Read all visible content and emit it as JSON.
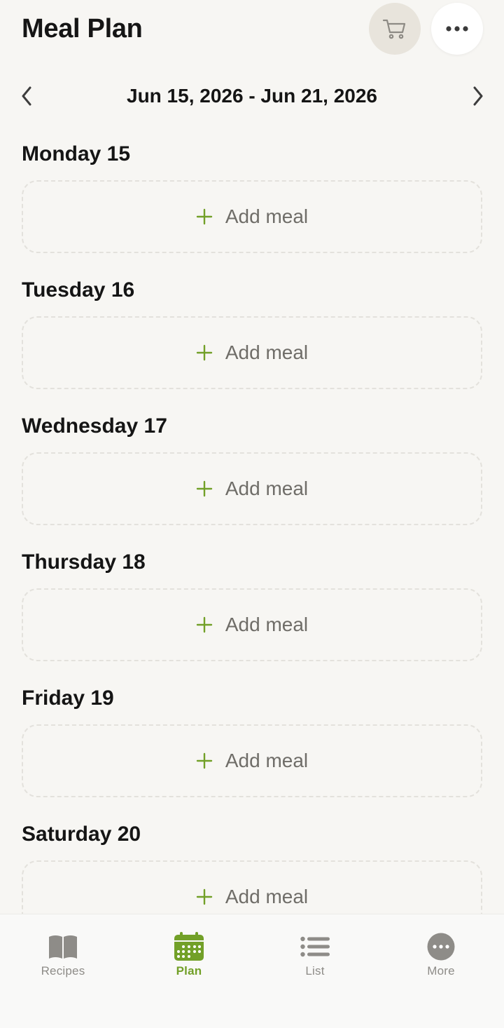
{
  "header": {
    "title": "Meal Plan",
    "cart_icon": "shopping-cart-icon",
    "more_icon": "ellipsis-icon"
  },
  "week_nav": {
    "range": "Jun 15, 2026 - Jun 21, 2026",
    "prev_icon": "chevron-left-icon",
    "next_icon": "chevron-right-icon"
  },
  "days": [
    {
      "label": "Monday 15",
      "add_label": "Add meal"
    },
    {
      "label": "Tuesday 16",
      "add_label": "Add meal"
    },
    {
      "label": "Wednesday 17",
      "add_label": "Add meal"
    },
    {
      "label": "Thursday 18",
      "add_label": "Add meal"
    },
    {
      "label": "Friday 19",
      "add_label": "Add meal"
    },
    {
      "label": "Saturday 20",
      "add_label": "Add meal"
    }
  ],
  "tabs": [
    {
      "label": "Recipes",
      "icon": "book-icon",
      "active": false
    },
    {
      "label": "Plan",
      "icon": "calendar-icon",
      "active": true
    },
    {
      "label": "List",
      "icon": "list-icon",
      "active": false
    },
    {
      "label": "More",
      "icon": "more-circle-icon",
      "active": false
    }
  ],
  "colors": {
    "accent": "#72a028",
    "background": "#f7f6f3",
    "text": "#151515",
    "muted": "#8e8c88"
  }
}
